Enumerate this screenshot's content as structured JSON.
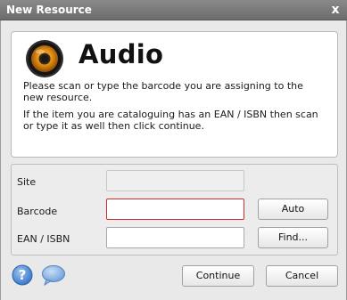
{
  "window": {
    "title": "New Resource",
    "close_glyph": "x"
  },
  "header": {
    "icon": "speaker-icon",
    "title": "Audio",
    "description_1": "Please scan or type the barcode you are assigning to the new resource.",
    "description_2": "If the item you are cataloguing has an EAN / ISBN then scan or type it as well then click continue."
  },
  "form": {
    "site_label": "Site",
    "site_value": "",
    "barcode_label": "Barcode",
    "barcode_value": "",
    "ean_label": "EAN / ISBN",
    "ean_value": "",
    "auto_button": "Auto",
    "find_button": "Find..."
  },
  "footer": {
    "help_icon": "help-icon",
    "chat_icon": "chat-bubble-icon",
    "continue_button": "Continue",
    "cancel_button": "Cancel"
  },
  "colors": {
    "titlebar": "#7a7a7a",
    "error_border": "#d22c2c",
    "icon_blue": "#4a86d0"
  }
}
